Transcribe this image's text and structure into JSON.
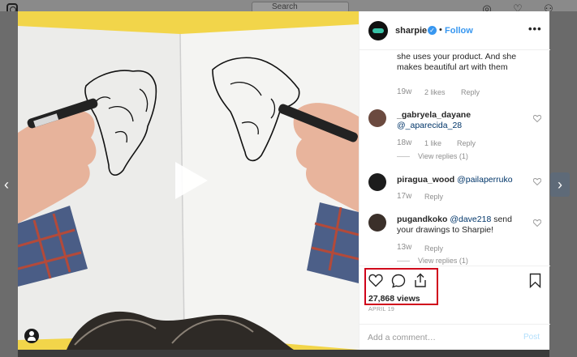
{
  "topbar": {
    "search_placeholder": "Search"
  },
  "icons": {
    "instagram": "instagram-logo-icon",
    "search": "search-icon",
    "explore": "compass-icon",
    "activity": "heart-icon",
    "profile": "person-icon"
  },
  "post": {
    "username": "sharpie",
    "verified": true,
    "dot": "•",
    "follow_label": "Follow",
    "more_label": "•••"
  },
  "comments": [
    {
      "username": "",
      "text": "she uses your product. And she makes beautiful art with them",
      "time": "19w",
      "likes": "2 likes",
      "reply_label": "Reply"
    },
    {
      "username": "_gabryela_dayane",
      "mention": "@_aparecida_28",
      "time": "18w",
      "likes": "1 like",
      "reply_label": "Reply",
      "view_replies": "View replies (1)"
    },
    {
      "username": "piragua_wood",
      "mention": "@pailaperruko",
      "time": "17w",
      "reply_label": "Reply"
    },
    {
      "username": "pugandkoko",
      "mention": "@dave218",
      "text": "send your drawings to Sharpie!",
      "time": "13w",
      "reply_label": "Reply",
      "view_replies": "View replies (1)"
    }
  ],
  "actions": {
    "views": "27,868 views",
    "date": "APRIL 19"
  },
  "add_comment": {
    "placeholder": "Add a comment…",
    "post_label": "Post"
  },
  "colors": {
    "accent": "#3897f0",
    "highlight": "#d0021b",
    "media_background": "#f2d54a"
  }
}
